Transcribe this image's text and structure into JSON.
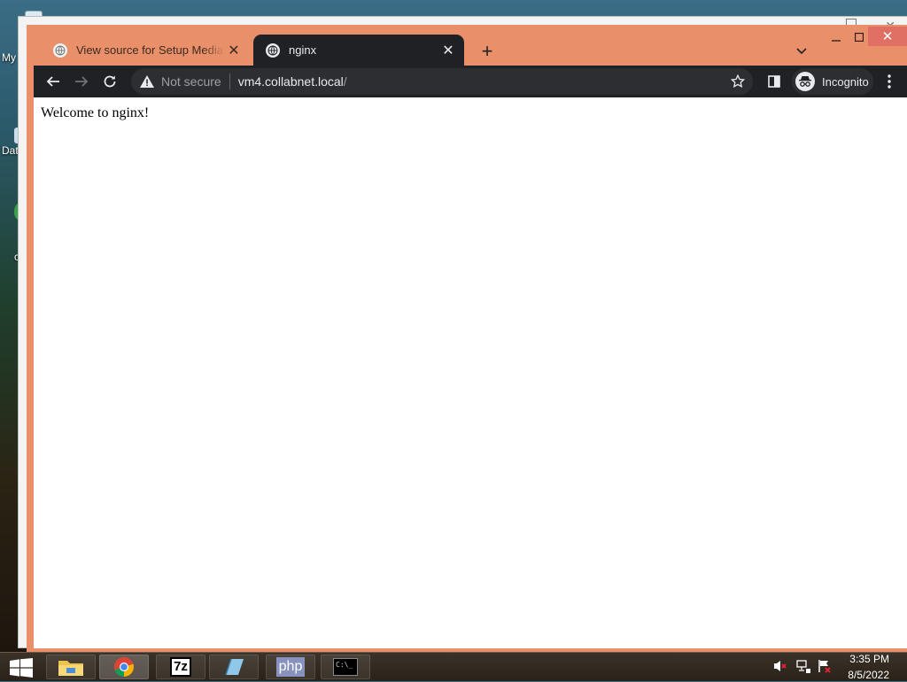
{
  "desktop": {
    "labels": [
      "My",
      "Dat",
      "c"
    ]
  },
  "browser": {
    "tabs": [
      {
        "title": "View source for Setup MediaWiki",
        "active": false
      },
      {
        "title": "nginx",
        "active": true
      }
    ],
    "new_tab_label": "+",
    "omnibox": {
      "security": "Not secure",
      "host": "vm4.collabnet.local",
      "path": "/"
    },
    "profile": "Incognito"
  },
  "page": {
    "text": "Welcome to nginx!"
  },
  "taskbar": {
    "apps": [
      "file-explorer",
      "chrome",
      "7-zip",
      "notepad",
      "php",
      "command-prompt"
    ],
    "sevenzip_label": "7z",
    "php_label": "php",
    "cmd_label": "C:\\_",
    "time": "3:35 PM",
    "date": "8/5/2022"
  },
  "colors": {
    "tab_strip": "#e9906a",
    "toolbar": "#202124",
    "omnibox": "#2d2e31",
    "close_button": "#e06f64"
  }
}
